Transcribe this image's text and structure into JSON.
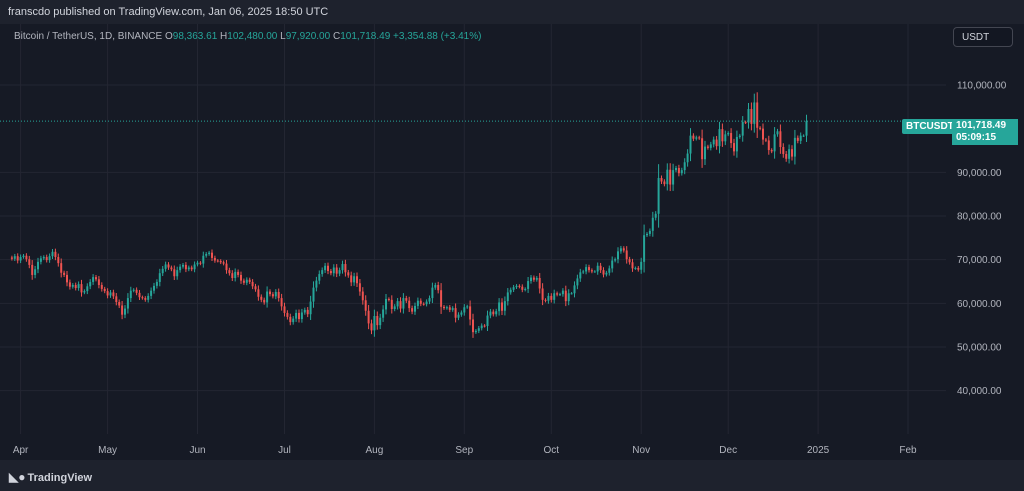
{
  "header": {
    "published_text": "franscdo published on TradingView.com, Jan 06, 2025 18:50 UTC"
  },
  "legend": {
    "symbol_line": "Bitcoin / TetherUS, 1D, BINANCE",
    "open_label": "O",
    "open": "98,363.61",
    "high_label": "H",
    "high": "102,480.00",
    "low_label": "L",
    "low": "97,920.00",
    "close_label": "C",
    "close": "101,718.49",
    "change": "+3,354.88 (+3.41%)"
  },
  "currency_button": "USDT",
  "price_tag": {
    "symbol": "BTCUSDT",
    "price": "101,718.49",
    "countdown": "05:09:15"
  },
  "footer": {
    "brand": "TradingView"
  },
  "colors": {
    "up": "#26a69a",
    "down": "#ef5350",
    "background": "#161a25",
    "grid": "#232632",
    "axis_text": "#b2b5be"
  },
  "icons": {
    "logo": "tradingview-logo-icon"
  },
  "chart_data": {
    "type": "candlestick",
    "symbol": "BTCUSDT",
    "interval": "1D",
    "ylim": [
      35000,
      115000
    ],
    "y_ticks": [
      {
        "value": 110000,
        "label": "110,000.00"
      },
      {
        "value": 90000,
        "label": "90,000.00"
      },
      {
        "value": 80000,
        "label": "80,000.00"
      },
      {
        "value": 70000,
        "label": "70,000.00"
      },
      {
        "value": 60000,
        "label": "60,000.00"
      },
      {
        "value": 50000,
        "label": "50,000.00"
      },
      {
        "value": 40000,
        "label": "40,000.00"
      }
    ],
    "x_ticks": [
      {
        "day": 4,
        "label": "Apr"
      },
      {
        "day": 34,
        "label": "May"
      },
      {
        "day": 65,
        "label": "Jun"
      },
      {
        "day": 95,
        "label": "Jul"
      },
      {
        "day": 126,
        "label": "Aug"
      },
      {
        "day": 157,
        "label": "Sep"
      },
      {
        "day": 187,
        "label": "Oct"
      },
      {
        "day": 218,
        "label": "Nov"
      },
      {
        "day": 248,
        "label": "Dec"
      },
      {
        "day": 279,
        "label": "2025"
      },
      {
        "day": 310,
        "label": "Feb"
      }
    ],
    "grid": true,
    "last_price": 101718.49,
    "closes": [
      70500,
      70200,
      70800,
      69800,
      70600,
      70900,
      70100,
      68800,
      66500,
      67800,
      69500,
      70300,
      70600,
      69900,
      70800,
      71800,
      70600,
      69200,
      67000,
      66500,
      64800,
      63800,
      64200,
      63500,
      64400,
      62500,
      62800,
      63900,
      64900,
      66000,
      65500,
      64200,
      63300,
      62800,
      61800,
      62500,
      61600,
      60300,
      59500,
      57400,
      58800,
      61200,
      62900,
      63100,
      62400,
      61400,
      61200,
      60800,
      61700,
      62900,
      64000,
      64900,
      66900,
      67900,
      68900,
      68200,
      67800,
      66200,
      67600,
      68400,
      68800,
      67800,
      68200,
      67800,
      68900,
      69300,
      69100,
      70900,
      71300,
      71600,
      70400,
      69800,
      69700,
      69400,
      69100,
      67600,
      66900,
      65800,
      67200,
      66500,
      65200,
      64700,
      65400,
      64900,
      63900,
      63200,
      61500,
      60800,
      60200,
      62700,
      62100,
      61600,
      62600,
      61200,
      59300,
      57800,
      56900,
      55700,
      56500,
      57800,
      56400,
      57900,
      58500,
      57500,
      60400,
      63600,
      65200,
      66700,
      67600,
      68600,
      67400,
      66900,
      68200,
      66800,
      67600,
      69000,
      67100,
      66400,
      64800,
      66200,
      64600,
      62700,
      60700,
      58300,
      55400,
      53800,
      57100,
      55000,
      56700,
      58600,
      61000,
      60800,
      58700,
      59300,
      60500,
      58800,
      61200,
      60600,
      58900,
      58100,
      59400,
      60600,
      59900,
      59800,
      60400,
      61200,
      63600,
      64200,
      63000,
      59200,
      58900,
      59100,
      58500,
      58900,
      56700,
      57400,
      57900,
      59100,
      59300,
      56300,
      53400,
      53700,
      54300,
      54900,
      54800,
      57200,
      58100,
      57500,
      58200,
      60200,
      58300,
      60500,
      62500,
      63100,
      63700,
      64000,
      63800,
      63100,
      63300,
      65100,
      65900,
      65400,
      65800,
      63400,
      60800,
      60600,
      61700,
      60800,
      62300,
      62000,
      62100,
      62900,
      60500,
      62300,
      62300,
      64100,
      65700,
      67100,
      67300,
      68300,
      67600,
      67300,
      67300,
      68600,
      67600,
      66600,
      67000,
      68000,
      69800,
      70100,
      71900,
      72600,
      72100,
      70100,
      69400,
      68000,
      68100,
      67700,
      69500,
      75600,
      75900,
      76600,
      79600,
      80500,
      88700,
      87900,
      87300,
      90600,
      87200,
      90500,
      91000,
      89800,
      90500,
      92300,
      94300,
      98400,
      97700,
      98000,
      97800,
      93000,
      95900,
      95600,
      96400,
      97500,
      96000,
      99900,
      97100,
      98700,
      99000,
      96700,
      94800,
      98100,
      98400,
      101500,
      101400,
      104500,
      101100,
      106000,
      100200,
      100000,
      97500,
      97300,
      95100,
      94800,
      98700,
      99400,
      95800,
      94200,
      93100,
      95300,
      93600,
      97900,
      97200,
      98400,
      98400,
      101718
    ]
  }
}
